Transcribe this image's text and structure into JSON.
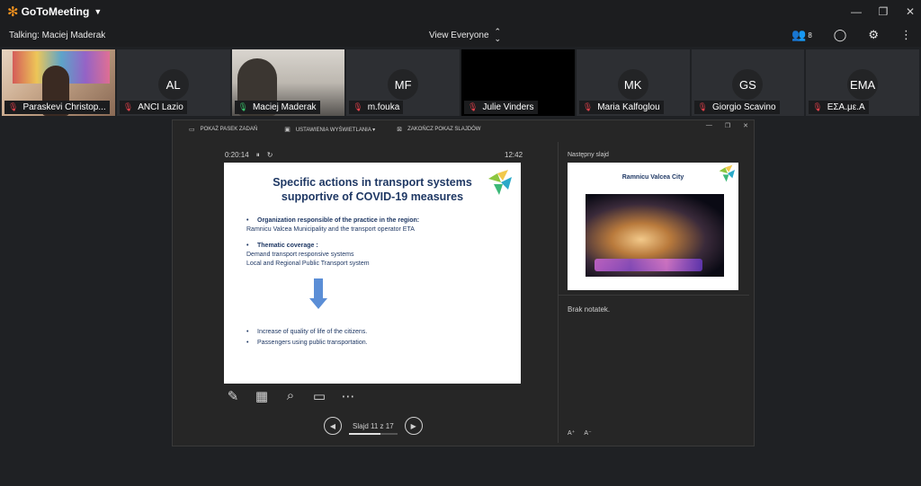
{
  "app": {
    "name": "GoToMeeting",
    "logo_glyph": "✻",
    "menu_caret": "▼",
    "window_controls": {
      "minimize": "—",
      "restore": "❐",
      "close": "✕"
    }
  },
  "infobar": {
    "talking": "Talking: Maciej Maderak",
    "view": "View Everyone",
    "view_arrows": {
      "up": "⌃",
      "down": "⌄"
    },
    "attendee_count": "8",
    "icons": {
      "attendees": "people-icon",
      "chat": "chat-icon",
      "settings": "gear-icon",
      "more": "more-vertical-icon"
    },
    "icon_glyphs": {
      "attendees": "👥",
      "chat": "◯",
      "settings": "⚙",
      "more": "⋮"
    }
  },
  "participants": [
    {
      "name": "Paraskevi Christop...",
      "initials": "",
      "video": "pp",
      "mic": "muted"
    },
    {
      "name": "ANCI Lazio",
      "initials": "AL",
      "video": "",
      "mic": "muted"
    },
    {
      "name": "Maciej Maderak",
      "initials": "",
      "video": "mm",
      "mic": "active"
    },
    {
      "name": "m.fouka",
      "initials": "MF",
      "video": "",
      "mic": "muted"
    },
    {
      "name": "Julie Vinders",
      "initials": "",
      "video": "dark",
      "mic": "muted"
    },
    {
      "name": "Maria Kalfoglou",
      "initials": "MK",
      "video": "",
      "mic": "muted"
    },
    {
      "name": "Giorgio Scavino",
      "initials": "GS",
      "video": "",
      "mic": "muted"
    },
    {
      "name": "ΕΣΑ.με.Α",
      "initials": "EMA",
      "video": "",
      "mic": "muted"
    }
  ],
  "mic_glyph": "🎙",
  "presenter": {
    "toolbar": {
      "show_taskbar": "POKAŻ PASEK ZADAŃ",
      "display_settings": "USTAWIENIA WYŚWIETLANIA ▾",
      "end_show": "ZAKOŃCZ POKAZ SLAJDÓW"
    },
    "toolbar_glyphs": {
      "taskbar": "▭",
      "display": "▣",
      "end": "⊠"
    },
    "window_glyphs": {
      "minimize": "—",
      "restore": "❐",
      "close": "✕"
    },
    "timer": "0:20:14",
    "timer_glyphs": {
      "pause": "⏸",
      "reset": "↻"
    },
    "clock": "12:42",
    "slide": {
      "title": "Specific actions in transport systems supportive of COVID-19 measures",
      "bullet1_label": "Organization responsible of the practice in the region:",
      "bullet1_text": "Ramnicu Valcea Municipality and the transport operator ETA",
      "bullet2_label": "Thematic coverage :",
      "bullet2_line1": "Demand transport responsive systems",
      "bullet2_line2": "Local and Regional Public Transport system",
      "bullet3": "Increase of quality of life of the citizens.",
      "bullet4": "Passengers using public transportation."
    },
    "tool_glyphs": {
      "pen": "✎",
      "slides": "▦",
      "zoom": "⌕",
      "screen": "▭",
      "more": "⋯"
    },
    "nav": {
      "prev": "◀",
      "next": "▶",
      "counter": "Slajd 11 z 17",
      "current": 11,
      "total": 17
    },
    "next_label": "Następny slajd",
    "next_slide_title": "Ramnicu Valcea City",
    "notes": "Brak notatek.",
    "font_ctrls": {
      "increase": "A⁺",
      "decrease": "A⁻"
    }
  }
}
